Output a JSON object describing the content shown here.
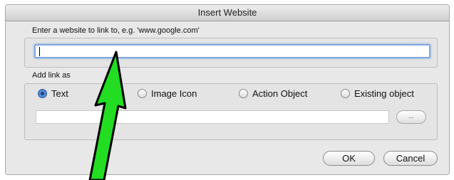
{
  "dialog": {
    "title": "Insert Website",
    "url_section": {
      "label": "Enter a website to link to, e.g. 'www.google.com'",
      "value": ""
    },
    "link_section": {
      "label": "Add link as",
      "options": [
        {
          "label": "Text",
          "selected": true
        },
        {
          "label": "Image Icon",
          "selected": false
        },
        {
          "label": "Action Object",
          "selected": false
        },
        {
          "label": "Existing object",
          "selected": false
        }
      ],
      "object_value": "",
      "browse_label": "..."
    },
    "buttons": {
      "ok": "OK",
      "cancel": "Cancel"
    }
  },
  "colors": {
    "focus": "#7fa8e0",
    "arrow": "#22dd22"
  }
}
